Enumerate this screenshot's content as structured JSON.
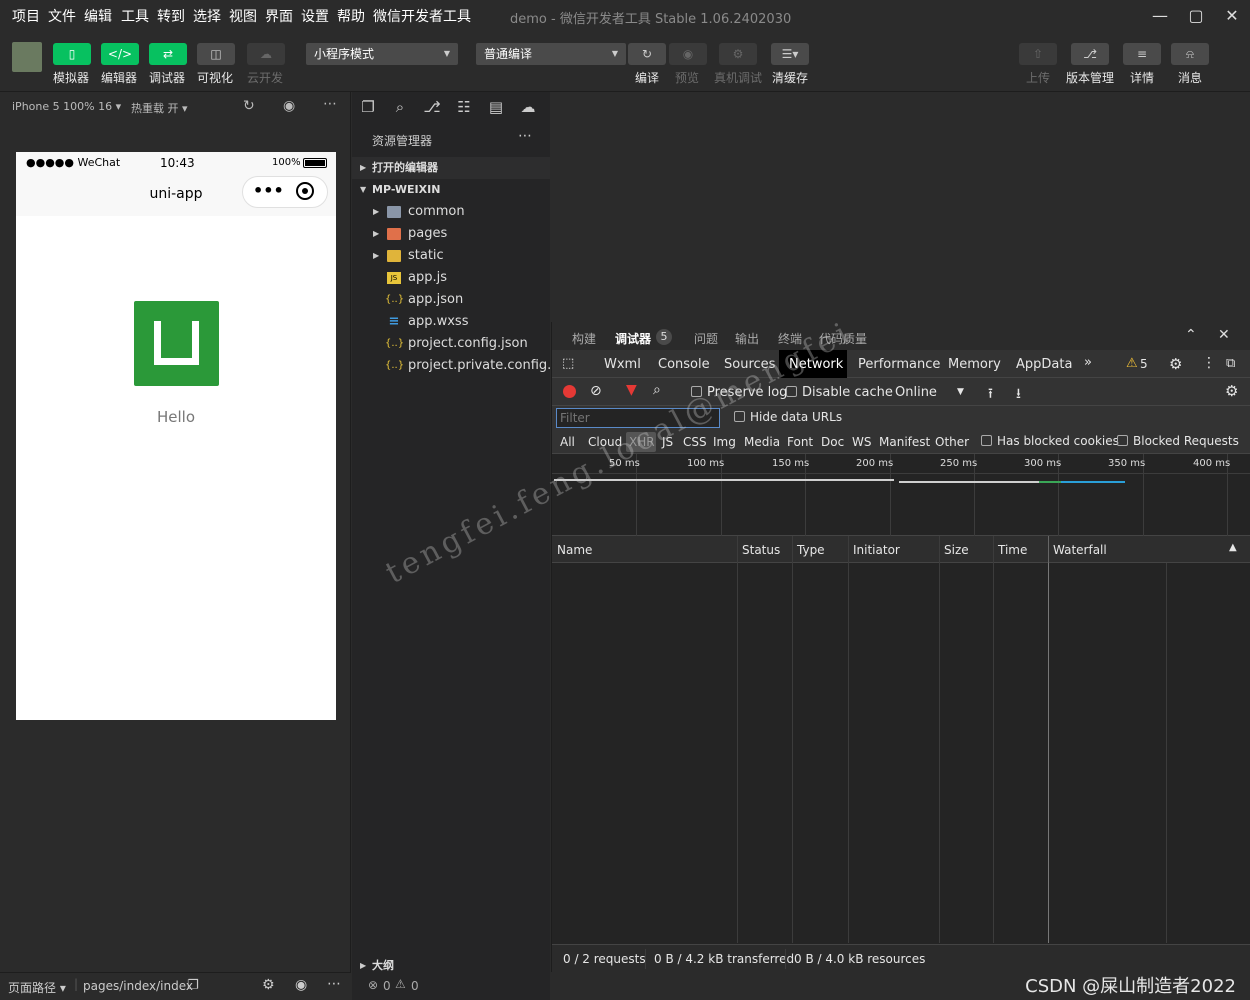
{
  "menu": [
    "项目",
    "文件",
    "编辑",
    "工具",
    "转到",
    "选择",
    "视图",
    "界面",
    "设置",
    "帮助",
    "微信开发者工具"
  ],
  "window_title": "demo - 微信开发者工具 Stable 1.06.2402030",
  "toolbar": {
    "left_buttons": [
      {
        "label": "模拟器",
        "icon": "phone-icon"
      },
      {
        "label": "编辑器",
        "icon": "code-icon"
      },
      {
        "label": "调试器",
        "icon": "debug-icon"
      },
      {
        "label": "可视化",
        "icon": "layout-icon"
      },
      {
        "label": "云开发",
        "icon": "cloud-icon"
      }
    ],
    "mode_select": "小程序模式",
    "compile_select": "普通编译",
    "mid_buttons": [
      {
        "label": "编译",
        "icon": "refresh-icon"
      },
      {
        "label": "预览",
        "icon": "eye-icon"
      },
      {
        "label": "真机调试",
        "icon": "bug-icon"
      },
      {
        "label": "清缓存",
        "icon": "layers-icon"
      }
    ],
    "right_buttons": [
      {
        "label": "上传",
        "icon": "upload-icon"
      },
      {
        "label": "版本管理",
        "icon": "branch-icon"
      },
      {
        "label": "详情",
        "icon": "menu-icon"
      },
      {
        "label": "消息",
        "icon": "bell-icon"
      }
    ]
  },
  "simulator": {
    "device": "iPhone 5 100% 16",
    "hot_reload": "热重载 开",
    "status_carrier": "●●●●● WeChat",
    "status_time": "10:43",
    "status_battery": "100%",
    "nav_title": "uni-app",
    "hello_text": "Hello"
  },
  "explorer": {
    "title": "资源管理器",
    "open_editors": "打开的编辑器",
    "project": "MP-WEIXIN",
    "items": [
      {
        "name": "common",
        "kind": "folder"
      },
      {
        "name": "pages",
        "kind": "folder"
      },
      {
        "name": "static",
        "kind": "folder"
      },
      {
        "name": "app.js",
        "kind": "js"
      },
      {
        "name": "app.json",
        "kind": "json"
      },
      {
        "name": "app.wxss",
        "kind": "wxss"
      },
      {
        "name": "project.config.json",
        "kind": "json"
      },
      {
        "name": "project.private.config.js...",
        "kind": "json"
      }
    ],
    "outline": "大纲"
  },
  "devtools": {
    "top_tabs": [
      "构建",
      "调试器",
      "问题",
      "输出",
      "终端",
      "代码质量"
    ],
    "debugger_badge": "5",
    "panel_tabs": [
      "Wxml",
      "Console",
      "Sources",
      "Network",
      "Performance",
      "Memory",
      "AppData"
    ],
    "active_panel": "Network",
    "warning_count": "5",
    "preserve_log": "Preserve log",
    "disable_cache": "Disable cache",
    "throttle": "Online",
    "filter_placeholder": "Filter",
    "hide_data_urls": "Hide data URLs",
    "types": [
      "All",
      "Cloud",
      "XHR",
      "JS",
      "CSS",
      "Img",
      "Media",
      "Font",
      "Doc",
      "WS",
      "Manifest",
      "Other"
    ],
    "active_type": "XHR",
    "has_blocked_cookies": "Has blocked cookies",
    "blocked_requests": "Blocked Requests",
    "timeline_ticks": [
      "50 ms",
      "100 ms",
      "150 ms",
      "200 ms",
      "250 ms",
      "300 ms",
      "350 ms",
      "400 ms"
    ],
    "columns": [
      "Name",
      "Status",
      "Type",
      "Initiator",
      "Size",
      "Time",
      "Waterfall"
    ],
    "status_requests": "0 / 2 requests",
    "status_transferred": "0 B / 4.2 kB transferred",
    "status_resources": "0 B / 4.0 kB resources"
  },
  "bottom": {
    "page_path_label": "页面路径",
    "page_path": "pages/index/index",
    "errors": "0",
    "warnings": "0"
  },
  "watermark": "tengfei.feng.local@mengfei",
  "csdn_mark": "CSDN @屎山制造者2022",
  "colors": {
    "accent_green": "#07c160",
    "uni_green": "#2b9939",
    "record_red": "#e53935",
    "filter_red": "#e53935"
  }
}
